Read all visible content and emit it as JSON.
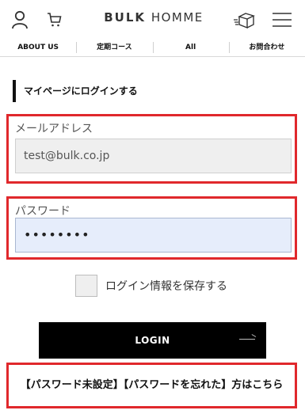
{
  "header": {
    "logo_bold": "BULK",
    "logo_light": "HOMME",
    "icons": [
      "user-icon",
      "cart-icon",
      "box-icon",
      "menu-icon"
    ]
  },
  "nav": {
    "items": [
      {
        "label": "ABOUT US"
      },
      {
        "label": "定期コース"
      },
      {
        "label": "All"
      },
      {
        "label": "お問合わせ"
      }
    ]
  },
  "login": {
    "section_title": "マイページにログインする",
    "email": {
      "label": "メールアドレス",
      "value": "test@bulk.co.jp"
    },
    "password": {
      "label": "パスワード",
      "value": "••••••••"
    },
    "remember_label": "ログイン情報を保存する",
    "login_button": "LOGIN",
    "forgot_link": "【パスワード未設定】【パスワードを忘れた】方はこちら"
  },
  "colors": {
    "highlight": "#e0282c",
    "button_bg": "#000000",
    "password_bg": "#e6edfb"
  }
}
